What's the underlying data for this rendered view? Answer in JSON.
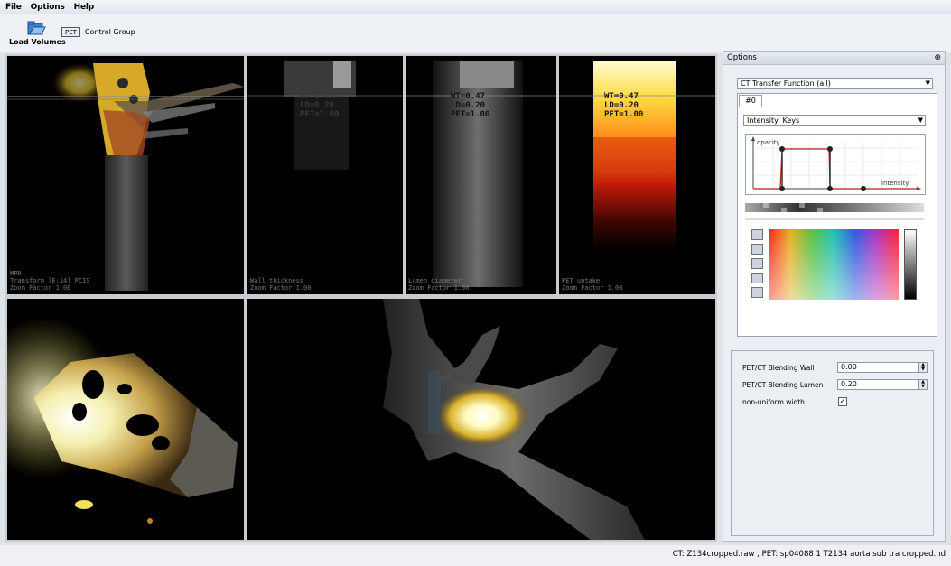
{
  "menu": {
    "file": "File",
    "options": "Options",
    "help": "Help"
  },
  "toolbar": {
    "load_label": "Load Volumes",
    "pet_badge": "PET",
    "group_label": "Control Group"
  },
  "viewports": {
    "top1": {
      "overlay": "MPR\nTransform [E:14] PCIS\nZoom Factor 1.00"
    },
    "top2": {
      "roi": "WT=0.47\nLD=0.20\nPET=1.00",
      "overlay": "Wall thickness\nZoom Factor 1.00"
    },
    "top3": {
      "roi": "WT=0.47\nLD=0.20\nPET=1.00",
      "overlay": "Lumen diameter\nZoom Factor 1.00"
    },
    "top4": {
      "roi": "WT=0.47\nLD=0.20\nPET=1.00",
      "overlay": "PET uptake\nZoom Factor 1.00"
    }
  },
  "options_panel": {
    "title": "Options",
    "tf_dropdown": "CT Transfer Function (all)",
    "tab_label": "#0",
    "intensity_dropdown": "Intensity: Keys",
    "axis_y": "opacity",
    "axis_x": "intensity",
    "blend_wall_label": "PET/CT Blending Wall",
    "blend_wall_value": "0.00",
    "blend_lumen_label": "PET/CT Blending Lumen",
    "blend_lumen_value": "0.20",
    "nonuniform_label": "non-uniform width",
    "nonuniform_checked": true
  },
  "statusbar": {
    "text": "CT: Z134cropped.raw , PET: sp04088 1 T2134 aorta sub tra cropped.hd"
  }
}
